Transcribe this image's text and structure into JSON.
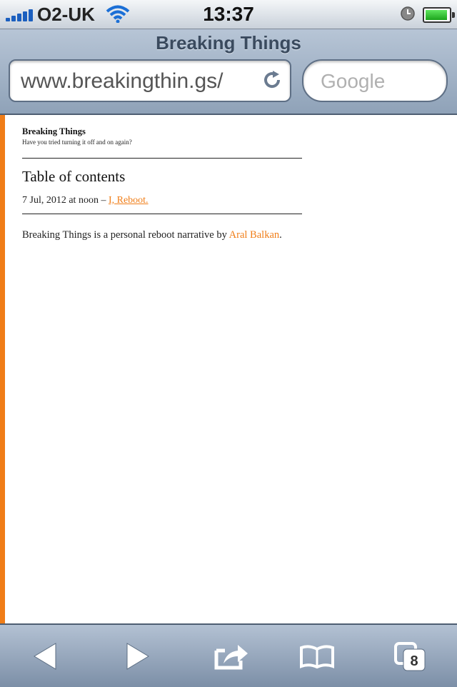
{
  "status": {
    "carrier": "O2-UK",
    "time": "13:37"
  },
  "browser": {
    "title": "Breaking Things",
    "url": "www.breakingthin.gs/",
    "search_placeholder": "Google",
    "tab_count": "8"
  },
  "page": {
    "blog_title": "Breaking Things",
    "tagline": "Have you tried turning it off and on again?",
    "toc_heading": "Table of contents",
    "toc_entries": [
      {
        "date": "7 Jul, 2012 at noon – ",
        "link": "I, Reboot."
      }
    ],
    "about": {
      "prefix": "Breaking Things is a personal reboot narrative by ",
      "author": "Aral Balkan",
      "suffix": "."
    }
  },
  "colors": {
    "accent": "#f07d17",
    "nav": "#8fa2b8"
  },
  "icons": [
    "signal-bars-icon",
    "wifi-icon",
    "alarm-clock-icon",
    "battery-icon",
    "reload-icon",
    "back-arrow-icon",
    "forward-arrow-icon",
    "share-icon",
    "bookmarks-icon",
    "pages-icon"
  ]
}
